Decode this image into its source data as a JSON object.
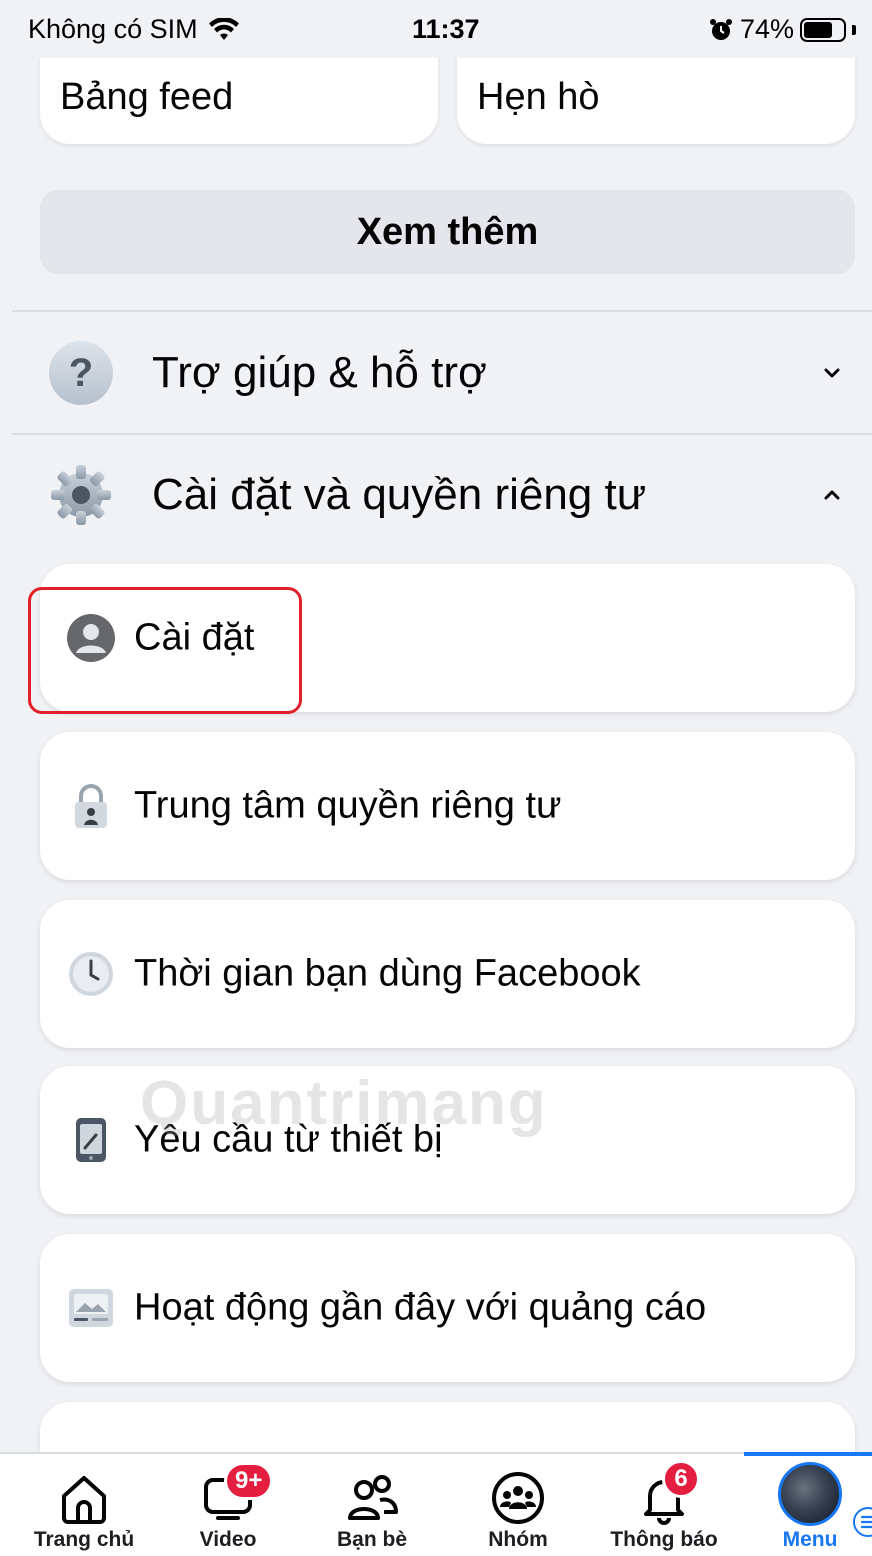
{
  "status_bar": {
    "carrier": "Không có SIM",
    "time": "11:37",
    "battery_percent": "74%",
    "battery_level": 0.74
  },
  "shortcuts": [
    {
      "label": "Bảng feed"
    },
    {
      "label": "Hẹn hò"
    }
  ],
  "see_more_label": "Xem thêm",
  "sections": {
    "help": {
      "title": "Trợ giúp & hỗ trợ",
      "icon": "question-icon",
      "expanded": false
    },
    "settings_privacy": {
      "title": "Cài đặt và quyền riêng tư",
      "icon": "gear-icon",
      "expanded": true
    }
  },
  "settings_items": [
    {
      "label": "Cài đặt",
      "icon": "profile-icon",
      "highlighted": true
    },
    {
      "label": "Trung tâm quyền riêng tư",
      "icon": "lock-icon"
    },
    {
      "label": "Thời gian bạn dùng Facebook",
      "icon": "clock-icon"
    },
    {
      "label": "Yêu cầu từ thiết bị",
      "icon": "phone-icon"
    },
    {
      "label": "Hoạt động gần đây với quảng cáo",
      "icon": "ad-activity-icon"
    }
  ],
  "watermark_text": "Quantrimang",
  "tab_bar": {
    "tabs": [
      {
        "label": "Trang chủ",
        "icon": "home-icon"
      },
      {
        "label": "Video",
        "icon": "video-icon",
        "badge": "9+"
      },
      {
        "label": "Bạn bè",
        "icon": "friends-icon"
      },
      {
        "label": "Nhóm",
        "icon": "groups-icon"
      },
      {
        "label": "Thông báo",
        "icon": "bell-icon",
        "badge": "6"
      },
      {
        "label": "Menu",
        "icon": "avatar-menu-icon",
        "active": true
      }
    ]
  },
  "colors": {
    "accent": "#1877f2",
    "badge": "#e41e3f",
    "highlight_border": "#e0202a",
    "background": "#f0f2f5"
  }
}
